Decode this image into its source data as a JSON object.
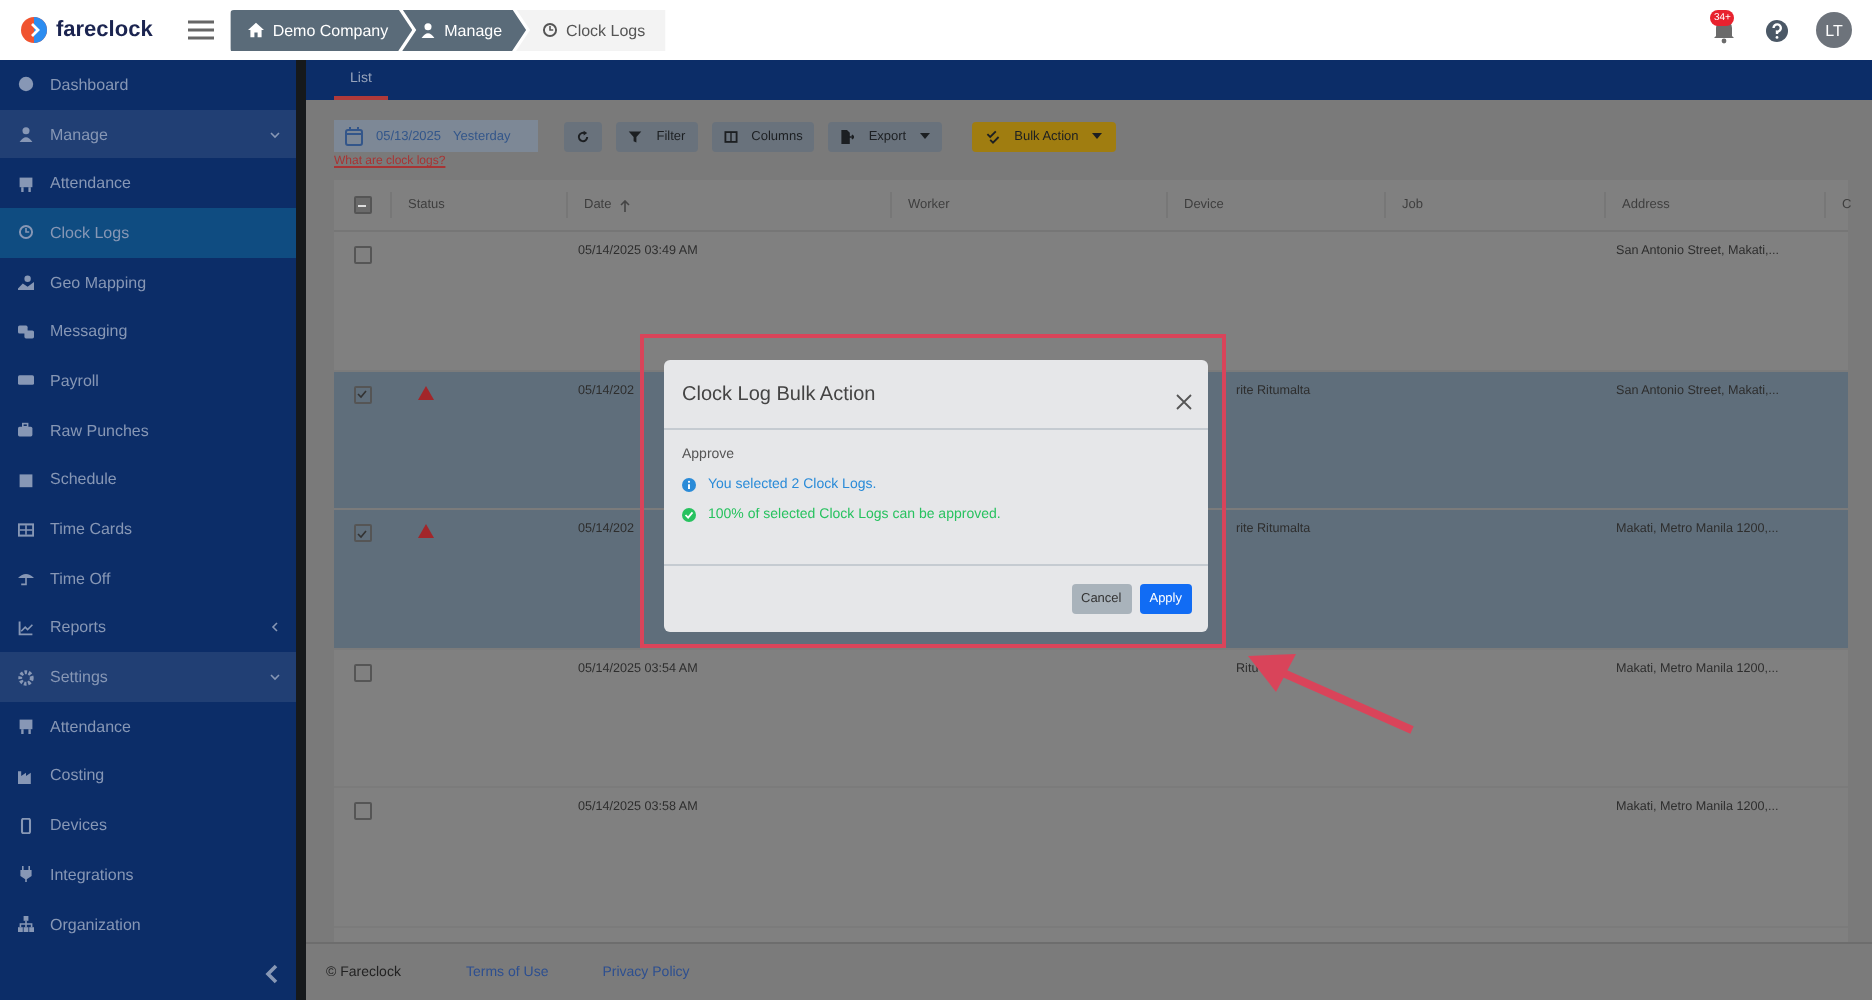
{
  "header": {
    "logo": "fareclock",
    "breadcrumbs": [
      {
        "label": "Demo Company",
        "selected": false
      },
      {
        "label": "Manage",
        "selected": false
      },
      {
        "label": "Clock Logs",
        "selected": true
      }
    ],
    "notification_badge": "34+",
    "avatar": "LT"
  },
  "sidebar": {
    "items": [
      {
        "label": "Dashboard",
        "kind": "item",
        "selected": false
      },
      {
        "label": "Manage",
        "kind": "group",
        "selected": false,
        "expanded": true
      },
      {
        "label": "Attendance",
        "kind": "item",
        "selected": false
      },
      {
        "label": "Clock Logs",
        "kind": "item",
        "selected": true
      },
      {
        "label": "Geo Mapping",
        "kind": "item",
        "selected": false
      },
      {
        "label": "Messaging",
        "kind": "item",
        "selected": false
      },
      {
        "label": "Payroll",
        "kind": "item",
        "selected": false
      },
      {
        "label": "Raw Punches",
        "kind": "item",
        "selected": false
      },
      {
        "label": "Schedule",
        "kind": "item",
        "selected": false
      },
      {
        "label": "Time Cards",
        "kind": "item",
        "selected": false
      },
      {
        "label": "Time Off",
        "kind": "item",
        "selected": false
      },
      {
        "label": "Reports",
        "kind": "group",
        "selected": false,
        "expanded": false
      },
      {
        "label": "Settings",
        "kind": "group",
        "selected": false,
        "expanded": true
      },
      {
        "label": "Attendance",
        "kind": "item",
        "selected": false
      },
      {
        "label": "Costing",
        "kind": "item",
        "selected": false
      },
      {
        "label": "Devices",
        "kind": "item",
        "selected": false
      },
      {
        "label": "Integrations",
        "kind": "item",
        "selected": false
      },
      {
        "label": "Organization",
        "kind": "item",
        "selected": false
      }
    ]
  },
  "tabs": [
    {
      "label": "List",
      "selected": true
    }
  ],
  "toolbar": {
    "date": "05/13/2025",
    "date_preset": "Yesterday",
    "buttons": [
      {
        "kind": "refresh"
      },
      {
        "label": "Filter",
        "kind": "filter"
      },
      {
        "label": "Columns",
        "kind": "columns"
      },
      {
        "label": "Export",
        "kind": "export"
      },
      {
        "label": "Bulk Action",
        "kind": "bulk"
      }
    ],
    "help_link": "What are clock logs?"
  },
  "table": {
    "select_all": {
      "indeterminate": true
    },
    "columns": [
      "Status",
      "Date",
      "Worker",
      "Device",
      "Job",
      "Address",
      "C"
    ],
    "rows": [
      {
        "selected": false,
        "warning": false,
        "date": "05/14/2025 03:49 AM",
        "address": "San Antonio Street, Makati,..."
      },
      {
        "selected": true,
        "warning": true,
        "date": "05/14/202",
        "device": "rite Ritumalta",
        "address": "San Antonio Street, Makati,..."
      },
      {
        "selected": true,
        "warning": true,
        "date": "05/14/202",
        "device": "rite Ritumalta",
        "address": "Makati, Metro Manila 1200,..."
      },
      {
        "selected": false,
        "warning": false,
        "date": "05/14/2025 03:54 AM",
        "device": "Ritu",
        "address": "Makati, Metro Manila 1200,..."
      },
      {
        "selected": false,
        "warning": false,
        "date": "05/14/2025 03:58 AM",
        "address": "Makati, Metro Manila 1200,..."
      }
    ]
  },
  "footer": {
    "copyright": "© Fareclock",
    "links": [
      "Terms of Use",
      "Privacy Policy"
    ]
  },
  "modal": {
    "title": "Clock Log Bulk Action",
    "action": "Approve",
    "messages": [
      {
        "kind": "info",
        "text": "You selected 2 Clock Logs."
      },
      {
        "kind": "success",
        "text": "100% of selected Clock Logs can be approved."
      }
    ],
    "buttons": [
      {
        "label": "Cancel",
        "kind": "secondary"
      },
      {
        "label": "Apply",
        "kind": "primary"
      }
    ]
  }
}
